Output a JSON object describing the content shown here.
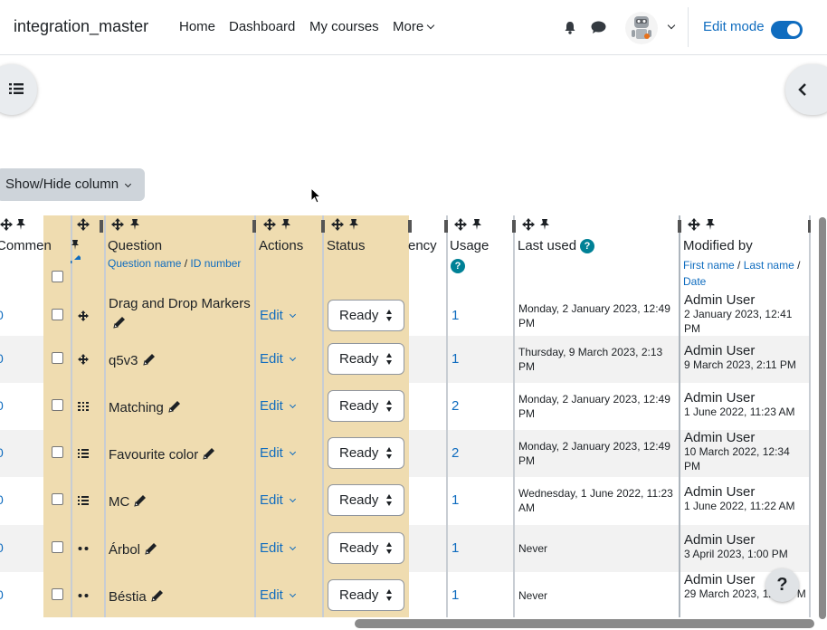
{
  "header": {
    "site_name": "integration_master",
    "nav": [
      "Home",
      "Dashboard",
      "My courses",
      "More"
    ],
    "edit_mode_label": "Edit mode",
    "edit_mode_on": true
  },
  "toolbar": {
    "show_hide_label": "Show/Hide column"
  },
  "table": {
    "columns": {
      "comments": "Commen",
      "question": "Question",
      "question_sort_name": "Question name",
      "question_sort_sep": " / ",
      "question_sort_id": "ID number",
      "actions": "Actions",
      "status": "Status",
      "frequency": "ency",
      "usage": "Usage",
      "last_used": "Last used",
      "modified_by": "Modified by",
      "mod_first": "First name",
      "mod_sep1": " / ",
      "mod_last": "Last name",
      "mod_sep2": " /",
      "mod_date": "Date",
      "help_glyph": "?"
    },
    "edit_label": "Edit",
    "rows": [
      {
        "name": "Drag and Drop Markers",
        "type_icon": "move-icon",
        "status": "Ready",
        "usage": "1",
        "last_used": "Monday, 2 January 2023, 12:49 PM",
        "mod_by": "Admin User",
        "mod_date": "2 January 2023, 12:41 PM"
      },
      {
        "name": "q5v3",
        "type_icon": "move-icon",
        "status": "Ready",
        "usage": "1",
        "last_used": "Thursday, 9 March 2023, 2:13 PM",
        "mod_by": "Admin User",
        "mod_date": "9 March 2023, 2:11 PM"
      },
      {
        "name": "Matching",
        "type_icon": "matching-icon",
        "status": "Ready",
        "usage": "2",
        "last_used": "Monday, 2 January 2023, 12:49 PM",
        "mod_by": "Admin User",
        "mod_date": "1 June 2022, 11:23 AM"
      },
      {
        "name": "Favourite color",
        "type_icon": "list-icon",
        "status": "Ready",
        "usage": "2",
        "last_used": "Monday, 2 January 2023, 12:49 PM",
        "mod_by": "Admin User",
        "mod_date": "10 March 2022, 12:34 PM"
      },
      {
        "name": "MC",
        "type_icon": "list-icon",
        "status": "Ready",
        "usage": "1",
        "last_used": "Wednesday, 1 June 2022, 11:23 AM",
        "mod_by": "Admin User",
        "mod_date": "1 June 2022, 11:22 AM"
      },
      {
        "name": "Árbol",
        "type_icon": "dots-icon",
        "status": "Ready",
        "usage": "1",
        "last_used": "Never",
        "mod_by": "Admin User",
        "mod_date": "3 April 2023, 1:00 PM"
      },
      {
        "name": "Béstia",
        "type_icon": "dots-icon",
        "status": "Ready",
        "usage": "1",
        "last_used": "Never",
        "mod_by": "Admin User",
        "mod_date": "29 March 2023, 12:... PM"
      }
    ]
  },
  "help_button": "?"
}
